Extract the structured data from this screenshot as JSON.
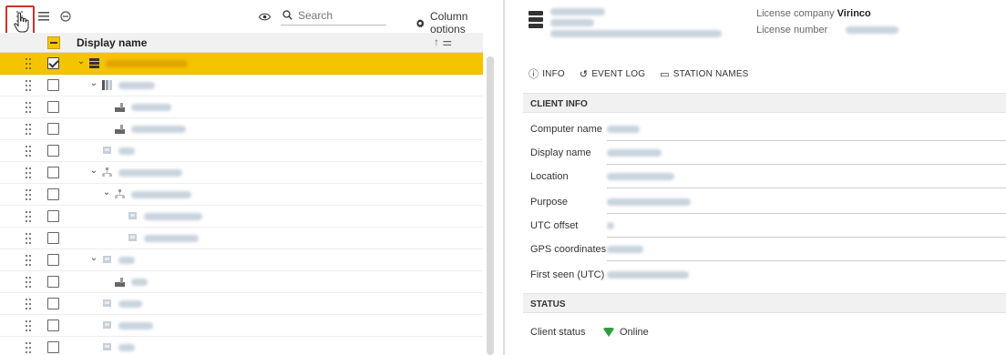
{
  "toolbar": {
    "search_placeholder": "Search",
    "column_options": "Column options"
  },
  "table": {
    "header_title": "Display name",
    "rows": [
      {
        "selected": true,
        "checked": true,
        "level": 0,
        "expanded": true,
        "icon": "server-icon"
      },
      {
        "selected": false,
        "checked": false,
        "level": 1,
        "expanded": true,
        "icon": "rack-icon"
      },
      {
        "selected": false,
        "checked": false,
        "level": 2,
        "expanded": false,
        "icon": "line-icon"
      },
      {
        "selected": false,
        "checked": false,
        "level": 2,
        "expanded": false,
        "icon": "line-icon"
      },
      {
        "selected": false,
        "checked": false,
        "level": 1,
        "expanded": false,
        "icon": "station-icon"
      },
      {
        "selected": false,
        "checked": false,
        "level": 1,
        "expanded": true,
        "icon": "hierarchy-icon"
      },
      {
        "selected": false,
        "checked": false,
        "level": 2,
        "expanded": true,
        "icon": "hierarchy-icon"
      },
      {
        "selected": false,
        "checked": false,
        "level": 3,
        "expanded": false,
        "icon": "station-icon"
      },
      {
        "selected": false,
        "checked": false,
        "level": 3,
        "expanded": false,
        "icon": "station-icon"
      },
      {
        "selected": false,
        "checked": false,
        "level": 1,
        "expanded": true,
        "icon": "station-icon"
      },
      {
        "selected": false,
        "checked": false,
        "level": 2,
        "expanded": false,
        "icon": "line-icon"
      },
      {
        "selected": false,
        "checked": false,
        "level": 1,
        "expanded": false,
        "icon": "station-icon"
      },
      {
        "selected": false,
        "checked": false,
        "level": 1,
        "expanded": false,
        "icon": "station-icon"
      },
      {
        "selected": false,
        "checked": false,
        "level": 1,
        "expanded": false,
        "icon": "station-icon"
      }
    ]
  },
  "detail": {
    "license_company_label": "License company",
    "license_company_value": "Virinco",
    "license_number_label": "License number",
    "tabs": [
      "INFO",
      "EVENT LOG",
      "STATION NAMES"
    ],
    "sections": {
      "client_info": "CLIENT INFO",
      "status": "STATUS"
    },
    "fields": [
      "Computer name",
      "Display name",
      "Location",
      "Purpose",
      "UTC offset",
      "GPS coordinates",
      "First seen (UTC)"
    ],
    "client_status_label": "Client status",
    "client_status_value": "Online"
  },
  "colors": {
    "selected_row": "#f5c400",
    "online": "#2e9d3f",
    "highlight_box": "#d0312d"
  }
}
